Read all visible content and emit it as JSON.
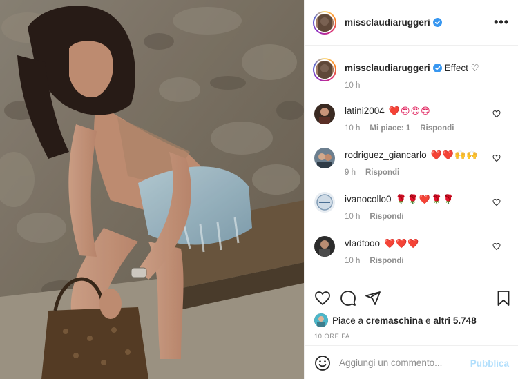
{
  "post": {
    "author": {
      "username": "missclaudiaruggeri",
      "verified": true
    },
    "caption": {
      "text": "Effect ♡",
      "time": "10 h"
    },
    "comments": [
      {
        "username": "latini2004",
        "emoji": "❤️😍😍😍",
        "time": "10 h",
        "likes_label": "Mi piace: 1",
        "reply_label": "Rispondi"
      },
      {
        "username": "rodriguez_giancarlo",
        "emoji": "❤️❤️🙌🙌",
        "time": "9 h",
        "likes_label": "",
        "reply_label": "Rispondi"
      },
      {
        "username": "ivanocollo0",
        "emoji": "🌹🌹❤️🌹🌹",
        "time": "10 h",
        "likes_label": "",
        "reply_label": "Rispondi"
      },
      {
        "username": "vladfooo",
        "emoji": "❤️❤️❤️",
        "time": "10 h",
        "likes_label": "",
        "reply_label": "Rispondi"
      }
    ],
    "likes": {
      "prefix": "Piace a",
      "user": "cremaschina",
      "connector": "e",
      "others": "altri 5.748"
    },
    "timestamp": "10 ORE FA",
    "composer": {
      "placeholder": "Aggiungi un commento...",
      "submit_label": "Pubblica"
    },
    "more_label": "•••"
  },
  "icons": {
    "verified": "verified-badge-icon",
    "like": "heart-outline-icon",
    "comment": "speech-bubble-icon",
    "share": "paper-plane-icon",
    "save": "bookmark-icon",
    "emoji": "smiley-icon"
  },
  "colors": {
    "verified_blue": "#3897f0",
    "muted_text": "#8e8e8e",
    "publish_disabled": "#b2dffc"
  }
}
